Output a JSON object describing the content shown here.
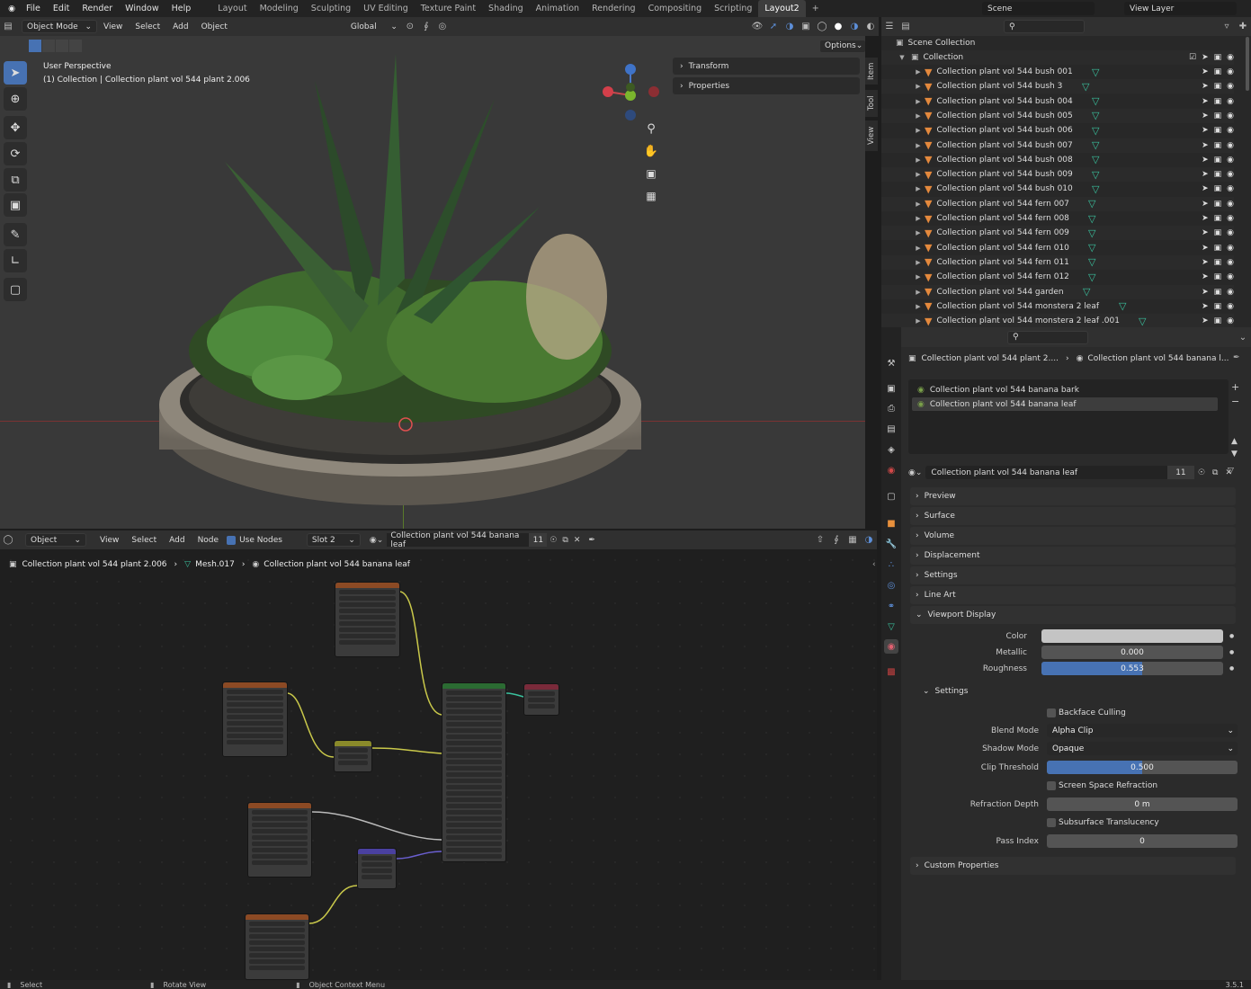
{
  "menu": [
    "File",
    "Edit",
    "Render",
    "Window",
    "Help"
  ],
  "workspaces": [
    "Layout",
    "Modeling",
    "Sculpting",
    "UV Editing",
    "Texture Paint",
    "Shading",
    "Animation",
    "Rendering",
    "Compositing",
    "Scripting",
    "Layout2"
  ],
  "scene": "Scene",
  "view_layer": "View Layer",
  "viewport_header": {
    "mode": "Object Mode",
    "menus": [
      "View",
      "Select",
      "Add",
      "Object"
    ],
    "orientation": "Global",
    "options": "Options"
  },
  "viewport_overlay": {
    "line1": "User Perspective",
    "line2": "(1) Collection | Collection plant vol 544 plant 2.006"
  },
  "npanel": {
    "tabs": [
      "Item",
      "Tool",
      "View"
    ],
    "sections": [
      "Transform",
      "Properties"
    ]
  },
  "outliner": {
    "root": "Scene Collection",
    "collection": "Collection",
    "items": [
      "Collection plant vol 544 bush 001",
      "Collection plant vol 544 bush 3",
      "Collection plant vol 544 bush 004",
      "Collection plant vol 544 bush 005",
      "Collection plant vol 544 bush 006",
      "Collection plant vol 544 bush 007",
      "Collection plant vol 544 bush 008",
      "Collection plant vol 544 bush 009",
      "Collection plant vol 544 bush 010",
      "Collection plant vol 544 fern 007",
      "Collection plant vol 544 fern 008",
      "Collection plant vol 544 fern 009",
      "Collection plant vol 544 fern 010",
      "Collection plant vol 544 fern 011",
      "Collection plant vol 544 fern 012",
      "Collection plant vol 544 garden",
      "Collection plant vol 544 monstera 2 leaf",
      "Collection plant vol 544 monstera 2 leaf .001"
    ]
  },
  "properties": {
    "breadcrumb_object": "Collection plant vol 544 plant 2....",
    "breadcrumb_material": "Collection plant vol 544 banana l...",
    "slots": [
      "Collection plant vol 544 banana bark",
      "Collection plant vol 544 banana leaf"
    ],
    "material_name": "Collection plant vol 544 banana leaf",
    "users": "11",
    "sections": [
      "Preview",
      "Surface",
      "Volume",
      "Displacement",
      "Settings",
      "Line Art",
      "Viewport Display"
    ],
    "vd": {
      "color_label": "Color",
      "metallic_label": "Metallic",
      "metallic": "0.000",
      "roughness_label": "Roughness",
      "roughness": "0.553",
      "roughness_fraction": 0.553
    },
    "settings_label": "Settings",
    "backface": "Backface Culling",
    "blend_label": "Blend Mode",
    "blend": "Alpha Clip",
    "shadow_label": "Shadow Mode",
    "shadow": "Opaque",
    "clip_label": "Clip Threshold",
    "clip": "0.500",
    "clip_fraction": 0.5,
    "ssr": "Screen Space Refraction",
    "refr_label": "Refraction Depth",
    "refr": "0 m",
    "sst": "Subsurface Translucency",
    "pass_label": "Pass Index",
    "pass": "0",
    "custom": "Custom Properties"
  },
  "node_editor": {
    "mode": "Object",
    "menus": [
      "View",
      "Select",
      "Add",
      "Node"
    ],
    "use_nodes": "Use Nodes",
    "slot": "Slot 2",
    "material": "Collection plant vol 544 banana leaf",
    "users": "11",
    "breadcrumb": [
      "Collection plant vol 544 plant 2.006",
      "Mesh.017",
      "Collection plant vol 544 banana leaf"
    ]
  },
  "status": {
    "select": "Select",
    "rotate": "Rotate View",
    "context": "Object Context Menu",
    "version": "3.5.1"
  }
}
